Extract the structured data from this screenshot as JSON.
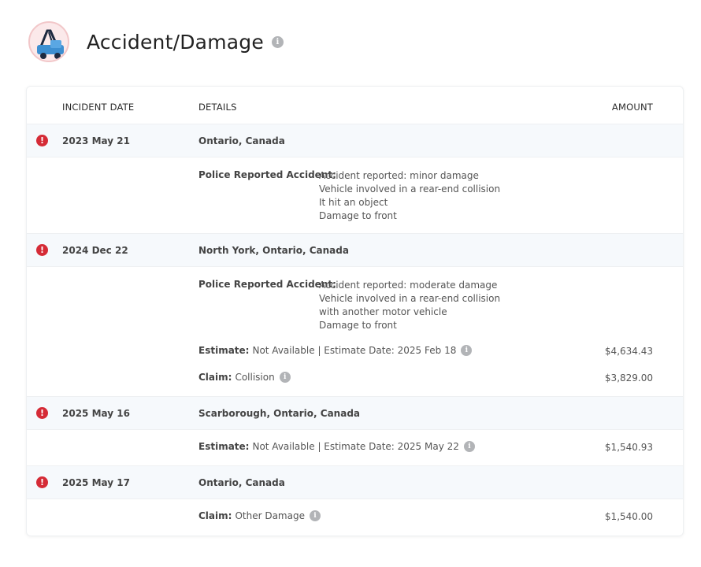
{
  "header": {
    "title": "Accident/Damage",
    "logo_icon": "tow-truck-icon",
    "info_icon": "info-icon"
  },
  "table": {
    "columns": {
      "date": "INCIDENT DATE",
      "details": "DETAILS",
      "amount": "AMOUNT"
    }
  },
  "incidents": [
    {
      "date": "2023 May 21",
      "location": "Ontario, Canada",
      "police_label": "Police Reported Accident:",
      "police_lines": [
        "Accident reported: minor damage",
        "Vehicle involved in a rear-end collision",
        "It hit an object",
        "Damage to front"
      ]
    },
    {
      "date": "2024 Dec 22",
      "location": "North York, Ontario, Canada",
      "police_label": "Police Reported Accident:",
      "police_lines": [
        "Accident reported: moderate damage",
        "Vehicle involved in a rear-end collision",
        "with another motor vehicle",
        "Damage to front"
      ],
      "estimate": {
        "label": "Estimate:",
        "text": "Not Available | Estimate Date: 2025 Feb 18",
        "amount": "$4,634.43"
      },
      "claim": {
        "label": "Claim:",
        "text": "Collision",
        "amount": "$3,829.00"
      }
    },
    {
      "date": "2025 May 16",
      "location": "Scarborough, Ontario, Canada",
      "estimate": {
        "label": "Estimate:",
        "text": "Not Available | Estimate Date: 2025 May 22",
        "amount": "$1,540.93"
      }
    },
    {
      "date": "2025 May 17",
      "location": "Ontario, Canada",
      "claim": {
        "label": "Claim:",
        "text": "Other Damage",
        "amount": "$1,540.00"
      }
    }
  ],
  "colors": {
    "alert": "#d52b36",
    "row_shade": "#f6f9fc",
    "info_gray": "#b2b4b7"
  }
}
